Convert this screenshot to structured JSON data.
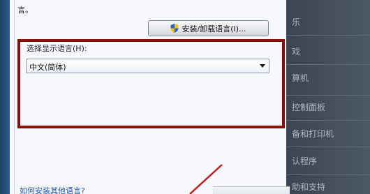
{
  "dialog": {
    "tail_text": "言。",
    "install_button_label": "安装/卸载语言(I)...",
    "display_language_label": "选择显示语言(H):",
    "display_language_value": "中文(简体)",
    "help_link": "如何安装其他语言?"
  },
  "start_menu": {
    "items": [
      {
        "label": "乐"
      },
      {
        "label": "戏"
      },
      {
        "label": "算机"
      },
      {
        "label": "控制面板"
      },
      {
        "label": "备和打印机"
      },
      {
        "label": "认程序"
      },
      {
        "label": "助和支持"
      }
    ]
  },
  "colors": {
    "highlight_border": "#8a1010",
    "link": "#1a55b8",
    "annotation_arrow": "#c0201e"
  }
}
